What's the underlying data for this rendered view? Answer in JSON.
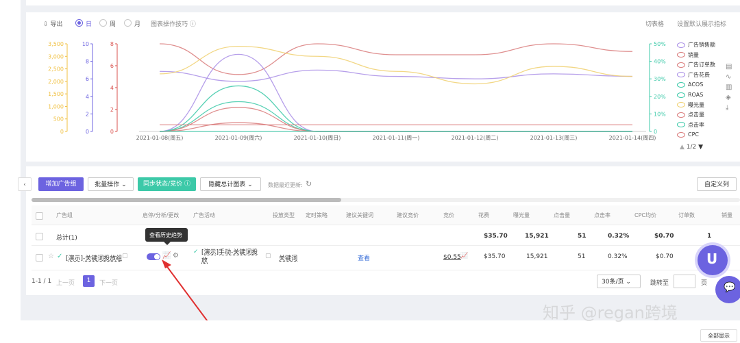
{
  "chart_toolbar": {
    "export": "导出",
    "day": "日",
    "week": "周",
    "month": "月",
    "tips": "图表操作技巧",
    "table_view": "切表格",
    "set_default": "设置默认展示指标"
  },
  "chart_data": {
    "type": "line",
    "x": [
      "2021-01-08(周五)",
      "2021-01-09(周六)",
      "2021-01-10(周日)",
      "2021-01-11(周一)",
      "2021-01-12(周二)",
      "2021-01-13(周三)",
      "2021-01-14(周四)"
    ],
    "y_axes": [
      {
        "ticks": [
          "3,500",
          "3,000",
          "2,500",
          "2,000",
          "1,500",
          "1,000",
          "500",
          "0"
        ],
        "color": "#f0c040"
      },
      {
        "ticks": [
          "10",
          "8",
          "6",
          "4",
          "2",
          "0"
        ],
        "color": "#6c63e0"
      },
      {
        "ticks": [
          "8",
          "6",
          "4",
          "2",
          "0"
        ],
        "color": "#d9534f"
      },
      {
        "ticks": [
          "50%",
          "40%",
          "30%",
          "20%",
          "10%",
          "0"
        ],
        "color": "#3cc9a8"
      }
    ],
    "series": [
      {
        "name": "广告销售额",
        "color": "#a98ee6",
        "values": [
          2400,
          2000,
          2450,
          2200,
          2100,
          2300,
          2200
        ],
        "axis": 0
      },
      {
        "name": "销量",
        "color": "#d97b7b",
        "values": [
          8,
          5.2,
          8,
          7,
          7,
          8,
          7.3
        ],
        "axis": 2
      },
      {
        "name": "广告订单数",
        "color": "#d97b7b",
        "values": [
          0,
          0.8,
          0,
          0,
          0,
          0,
          0
        ],
        "axis": 2
      },
      {
        "name": "广告花费",
        "color": "#a98ee6",
        "values": [
          0,
          8.8,
          0,
          0,
          0,
          0,
          0
        ],
        "axis": 1
      },
      {
        "name": "ACOS",
        "color": "#3cc9a8",
        "values": [
          0,
          0.17,
          0,
          0,
          0,
          0,
          0
        ],
        "axis": 3
      },
      {
        "name": "ROAS",
        "color": "#3cc9a8",
        "values": [
          0,
          0,
          0,
          0,
          0,
          0,
          0
        ],
        "axis": 3
      },
      {
        "name": "曝光量",
        "color": "#f0d070",
        "values": [
          2300,
          3400,
          3000,
          2400,
          1900,
          2600,
          2200
        ],
        "axis": 0
      },
      {
        "name": "点击量",
        "color": "#d97b7b",
        "values": [
          0,
          2.2,
          0,
          0,
          0,
          0,
          0
        ],
        "axis": 2
      },
      {
        "name": "点击率",
        "color": "#3cc9a8",
        "values": [
          0,
          0.26,
          0,
          0,
          0,
          0,
          0
        ],
        "axis": 3
      },
      {
        "name": "CPC",
        "color": "#d97b7b",
        "values": [
          0.6,
          0.6,
          0.6,
          0.6,
          0.6,
          0.6,
          0.6
        ],
        "axis": 2
      }
    ],
    "legend_page": "1/2"
  },
  "toolbar": {
    "add_group": "增加广告组",
    "batch": "批量操作",
    "sync": "同步状态/竞价",
    "hide_chart": "隐藏总计图表",
    "last_update": "数据最近更新:",
    "custom_columns": "自定义列"
  },
  "table": {
    "headers": [
      "广告组",
      "启停/分析/更改",
      "广告活动",
      "投放类型",
      "定时策略",
      "建议关键词",
      "建议竞价",
      "竞价",
      "花费",
      "曝光量",
      "点击量",
      "点击率",
      "CPC均价",
      "订单数",
      "销量"
    ],
    "total": {
      "label": "总计(1)",
      "spend": "$35.70",
      "impressions": "15,921",
      "clicks": "51",
      "ctr": "0.32%",
      "cpc": "$0.70",
      "orders": "1"
    },
    "row": {
      "group": "[演示]-关键词投放组",
      "campaign": "[演示]手动-关键词投放",
      "type": "关键词",
      "suggest": "查看",
      "bid": "$0.55",
      "spend": "$35.70",
      "impressions": "15,921",
      "clicks": "51",
      "ctr": "0.32%",
      "cpc": "$0.70"
    },
    "tooltip": "查看历史趋势"
  },
  "pagination": {
    "range": "1-1 / 1",
    "prev": "上一页",
    "page": "1",
    "next": "下一页",
    "page_size": "30条/页",
    "jump": "跳转至",
    "page_unit": "页"
  },
  "footer": {
    "show_all": "全部显示"
  },
  "watermark": "知乎 @regan跨境"
}
